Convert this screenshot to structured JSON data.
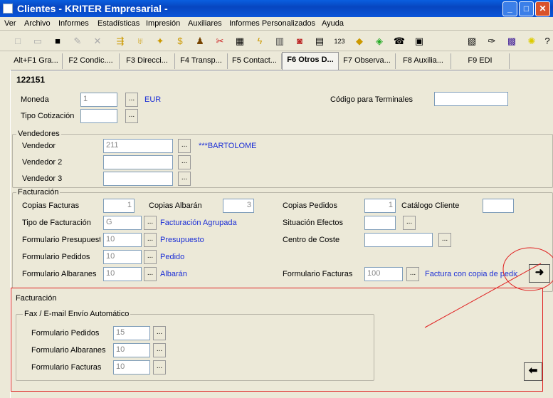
{
  "window": {
    "title": "Clientes - KRITER Empresarial -"
  },
  "menu": [
    "Ver",
    "Archivo",
    "Informes",
    "Estadísticas",
    "Impresión",
    "Auxiliares",
    "Informes Personalizados",
    "Ayuda"
  ],
  "tabs": [
    "Alt+F1 Gra...",
    "F2 Condic....",
    "F3 Direcci...",
    "F4 Transp...",
    "F5 Contact...",
    "F6 Otros D...",
    "F7 Observa...",
    "F8 Auxilia...",
    "F9 EDI"
  ],
  "record": {
    "code": "122151"
  },
  "general": {
    "moneda_label": "Moneda",
    "moneda_value": "1",
    "moneda_name": "EUR",
    "cotizacion_label": "Tipo Cotización",
    "cotizacion_value": "",
    "terminales_label": "Código para Terminales",
    "terminales_value": ""
  },
  "vendedores": {
    "title": "Vendedores",
    "v1_label": "Vendedor",
    "v1_value": "211",
    "v1_name": "***BARTOLOME",
    "v2_label": "Vendedor 2",
    "v2_value": "",
    "v3_label": "Vendedor 3",
    "v3_value": ""
  },
  "facturacion": {
    "title": "Facturación",
    "copias_facturas_label": "Copias Facturas",
    "copias_facturas_value": "1",
    "copias_albaran_label": "Copias Albarán",
    "copias_albaran_value": "3",
    "copias_pedidos_label": "Copias Pedidos",
    "copias_pedidos_value": "1",
    "catalogo_label": "Catálogo Cliente",
    "catalogo_value": "",
    "tipo_fact_label": "Tipo de Facturación",
    "tipo_fact_value": "G",
    "tipo_fact_name": "Facturación Agrupada",
    "situacion_label": "Situación Efectos",
    "situacion_value": "",
    "form_presupuesto_label": "Formulario Presupuesto",
    "form_presupuesto_value": "10",
    "form_presupuesto_name": "Presupuesto",
    "centro_coste_label": "Centro de Coste",
    "centro_coste_value": "",
    "form_pedidos_label": "Formulario Pedidos",
    "form_pedidos_value": "10",
    "form_pedidos_name": "Pedido",
    "form_albaranes_label": "Formulario Albaranes",
    "form_albaranes_value": "10",
    "form_albaranes_name": "Albarán",
    "form_facturas_label": "Formulario Facturas",
    "form_facturas_value": "100",
    "form_facturas_name": "Factura con copia de pedic"
  },
  "popup": {
    "title": "Facturación",
    "group_title": "Fax / E-mail Envío Automático",
    "pedidos_label": "Formulario Pedidos",
    "pedidos_value": "15",
    "albaranes_label": "Formulario Albaranes",
    "albaranes_value": "10",
    "facturas_label": "Formulario Facturas",
    "facturas_value": "10"
  },
  "colors": {
    "annotation": "#e02020",
    "link": "#1c2fd6",
    "titlebar": "#0a54d8"
  }
}
